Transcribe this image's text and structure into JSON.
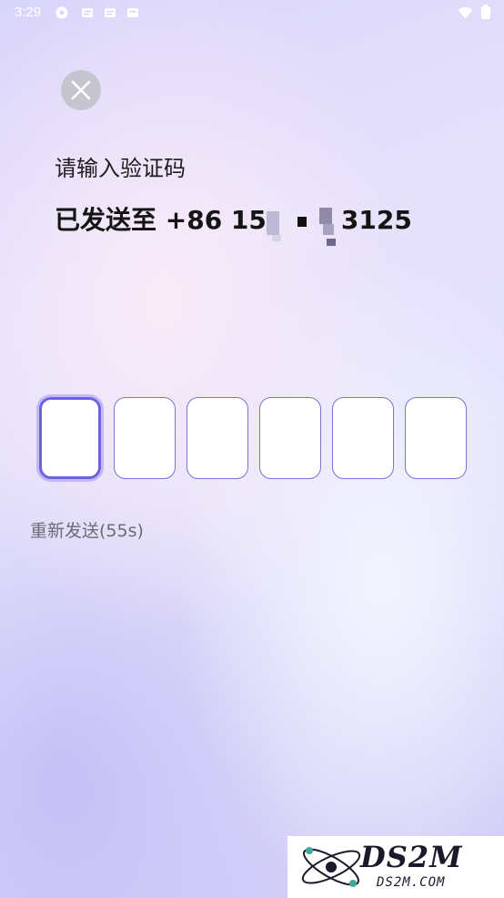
{
  "status_bar": {
    "time": "3:29",
    "icons": [
      "gear-icon",
      "notification-icon",
      "notification-icon",
      "notification-icon",
      "wifi-icon",
      "battery-icon"
    ]
  },
  "close_button": {
    "icon": "close-icon"
  },
  "title": "请输入验证码",
  "phone": {
    "prefix": "已发送至 +86 15",
    "suffix": "3125"
  },
  "code_input": {
    "length": 6,
    "values": [
      "",
      "",
      "",
      "",
      "",
      ""
    ],
    "focused_index": 0
  },
  "resend": {
    "label": "重新发送(55s)"
  },
  "watermark": {
    "brand": "DS2M",
    "url": "DS2M.COM"
  }
}
